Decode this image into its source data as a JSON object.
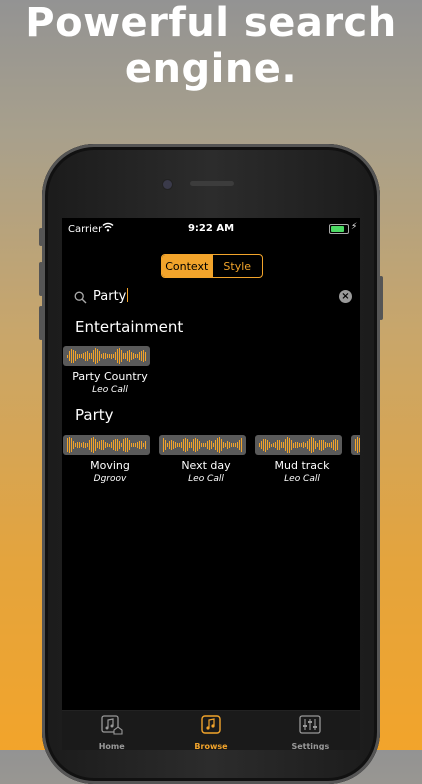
{
  "headline": [
    "Powerful search",
    "engine."
  ],
  "status": {
    "carrier": "Carrier",
    "time": "9:22 AM"
  },
  "segment": {
    "context": "Context",
    "style": "Style"
  },
  "search": {
    "query": "Party"
  },
  "sections": [
    {
      "title": "Entertainment",
      "items": [
        {
          "title": "Party Country",
          "artist": "Leo Call"
        }
      ]
    },
    {
      "title": "Party",
      "items": [
        {
          "title": "Moving",
          "artist": "Dgroov"
        },
        {
          "title": "Next day",
          "artist": "Leo Call"
        },
        {
          "title": "Mud track",
          "artist": "Leo Call"
        }
      ]
    }
  ],
  "tabs": [
    {
      "label": "Home",
      "icon": "home-music-icon",
      "active": false
    },
    {
      "label": "Browse",
      "icon": "browse-music-icon",
      "active": true
    },
    {
      "label": "Settings",
      "icon": "settings-sliders-icon",
      "active": false
    }
  ],
  "colors": {
    "accent": "#f2a42b",
    "screen": "#000000",
    "tabbar": "#1a1a1a"
  }
}
